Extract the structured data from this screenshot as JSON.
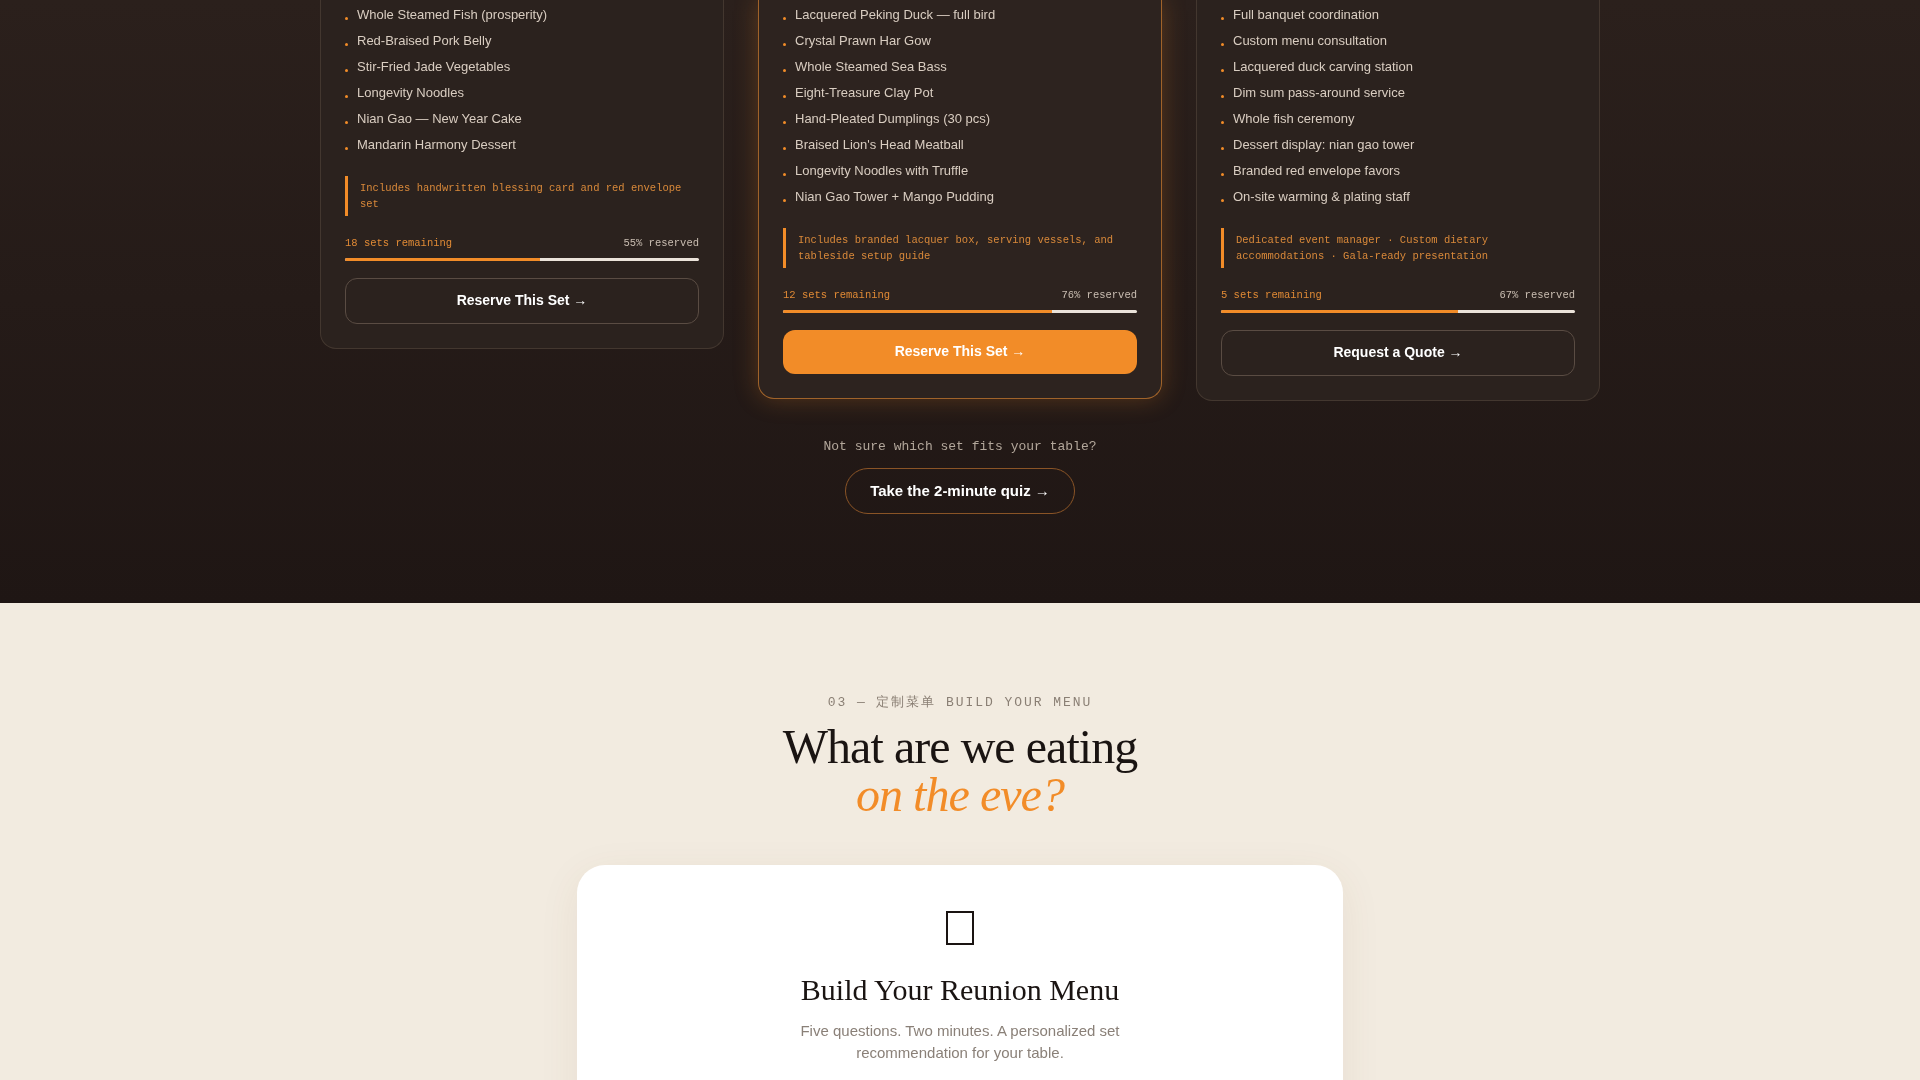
{
  "tiers": [
    {
      "featured": false,
      "items": [
        "Whole Steamed Fish (prosperity)",
        "Red-Braised Pork Belly",
        "Stir-Fried Jade Vegetables",
        "Longevity Noodles",
        "Nian Gao — New Year Cake",
        "Mandarin Harmony Dessert"
      ],
      "note": "Includes handwritten blessing card and red envelope set",
      "remaining": "18 sets remaining",
      "reserved": "55% reserved",
      "level": 0.55,
      "button": "Reserve This Set →"
    },
    {
      "featured": true,
      "items": [
        "Lacquered Peking Duck — full bird",
        "Crystal Prawn Har Gow",
        "Whole Steamed Sea Bass",
        "Eight-Treasure Clay Pot",
        "Hand-Pleated Dumplings (30 pcs)",
        "Braised Lion's Head Meatball",
        "Longevity Noodles with Truffle",
        "Nian Gao Tower + Mango Pudding"
      ],
      "note": "Includes branded lacquer box, serving vessels, and tableside setup guide",
      "remaining": "12 sets remaining",
      "reserved": "76% reserved",
      "level": 0.76,
      "button": "Reserve This Set →"
    },
    {
      "featured": false,
      "items": [
        "Full banquet coordination",
        "Custom menu consultation",
        "Lacquered duck carving station",
        "Dim sum pass-around service",
        "Whole fish ceremony",
        "Dessert display: nian gao tower",
        "Branded red envelope favors",
        "On-site warming & plating staff"
      ],
      "note": "Dedicated event manager · Custom dietary accommodations · Gala-ready presentation",
      "remaining": "5 sets remaining",
      "reserved": "67% reserved",
      "level": 0.67,
      "button": "Request a Quote →"
    }
  ],
  "quiz": {
    "prompt": "Not sure which set fits your table?",
    "button": "Take the 2-minute quiz →"
  },
  "build": {
    "eyebrow": "03 — 定制菜单 BUILD YOUR MENU",
    "headline": "What are we eating",
    "headline_accent": "on the eve?",
    "card_title": "Build Your Reunion Menu",
    "card_text": "Five questions. Two minutes. A personalized set recommendation for your table."
  }
}
